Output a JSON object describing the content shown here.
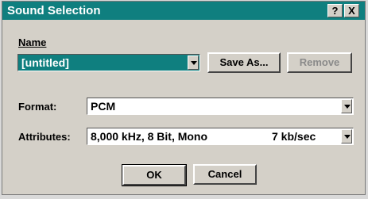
{
  "window": {
    "title": "Sound Selection",
    "help_label": "?",
    "close_label": "X"
  },
  "name": {
    "label": "Name",
    "value": "[untitled]"
  },
  "buttons": {
    "save_as": "Save As...",
    "remove": "Remove",
    "ok": "OK",
    "cancel": "Cancel"
  },
  "format": {
    "label": "Format:",
    "value": "PCM"
  },
  "attributes": {
    "label": "Attributes:",
    "value": "8,000 kHz, 8 Bit, Mono",
    "rate": "7 kb/sec"
  },
  "colors": {
    "title_bar": "#0f7f7f",
    "selection": "#0f7f7f",
    "window_face": "#d4d0c8"
  }
}
